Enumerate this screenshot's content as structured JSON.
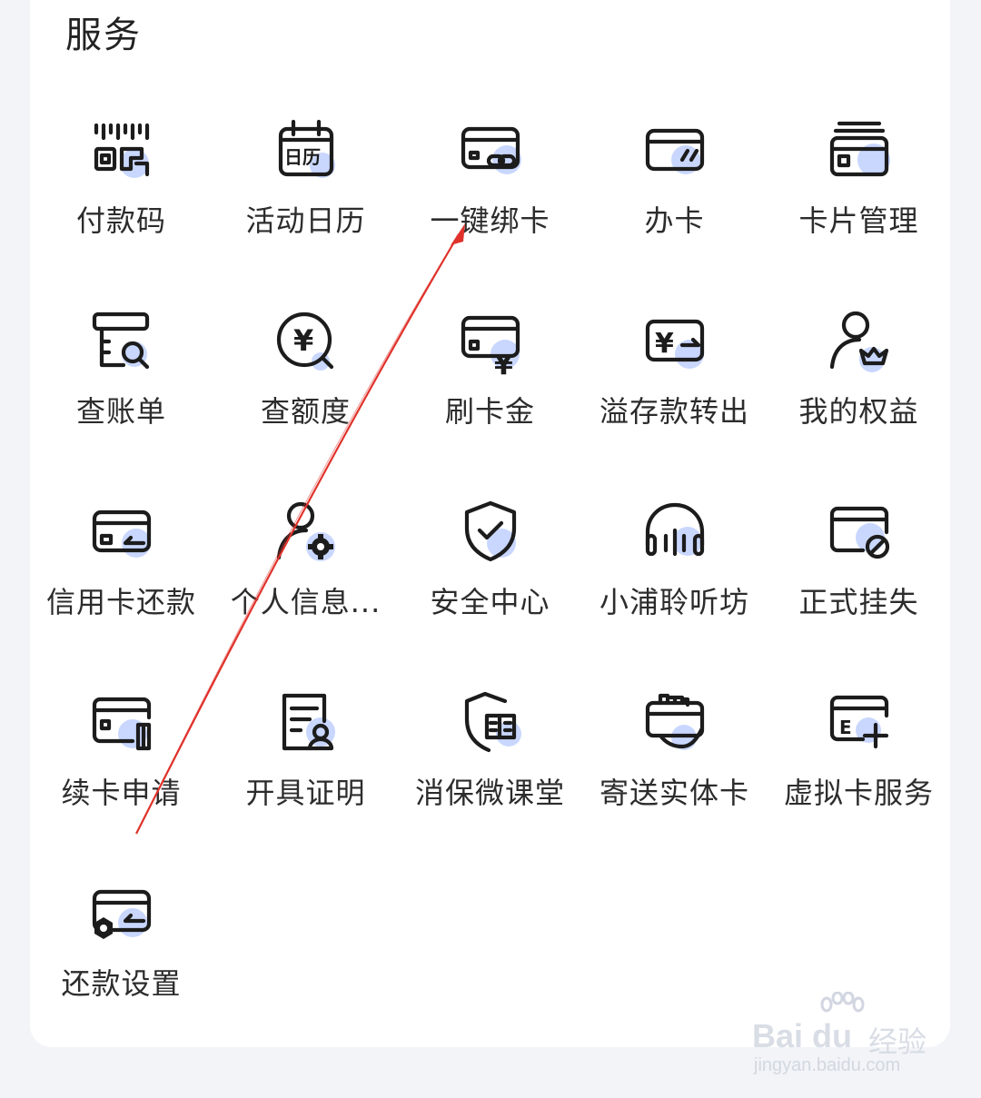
{
  "section": {
    "title": "服务"
  },
  "items": [
    {
      "label": "付款码",
      "icon": "barcode-qr-icon"
    },
    {
      "label": "活动日历",
      "icon": "calendar-icon",
      "icon_text": "日历"
    },
    {
      "label": "一键绑卡",
      "icon": "card-link-icon"
    },
    {
      "label": "办卡",
      "icon": "card-apply-icon"
    },
    {
      "label": "卡片管理",
      "icon": "card-stack-icon"
    },
    {
      "label": "查账单",
      "icon": "bill-search-icon"
    },
    {
      "label": "查额度",
      "icon": "yuan-search-icon",
      "icon_text": "¥"
    },
    {
      "label": "刷卡金",
      "icon": "card-yuan-icon",
      "icon_text": "¥"
    },
    {
      "label": "溢存款转出",
      "icon": "deposit-transfer-icon",
      "icon_text": "¥"
    },
    {
      "label": "我的权益",
      "icon": "user-crown-icon"
    },
    {
      "label": "信用卡还款",
      "icon": "card-repay-icon"
    },
    {
      "label": "个人信息...",
      "icon": "user-settings-icon"
    },
    {
      "label": "安全中心",
      "icon": "shield-check-icon"
    },
    {
      "label": "小浦聆听坊",
      "icon": "headphones-icon"
    },
    {
      "label": "正式挂失",
      "icon": "card-block-icon"
    },
    {
      "label": "续卡申请",
      "icon": "card-renew-icon"
    },
    {
      "label": "开具证明",
      "icon": "document-user-icon"
    },
    {
      "label": "消保微课堂",
      "icon": "shield-book-icon"
    },
    {
      "label": "寄送实体卡",
      "icon": "card-hand-icon"
    },
    {
      "label": "虚拟卡服务",
      "icon": "virtual-card-add-icon",
      "icon_text": "E"
    },
    {
      "label": "还款设置",
      "icon": "card-repay-settings-icon"
    }
  ],
  "watermark": {
    "brand": "Bai  du",
    "text": "经验",
    "url": "jingyan.baidu.com"
  },
  "colors": {
    "icon_stroke": "#1c1c1c",
    "icon_accent": "#c9d7ff",
    "annotation": "#e0322b"
  }
}
